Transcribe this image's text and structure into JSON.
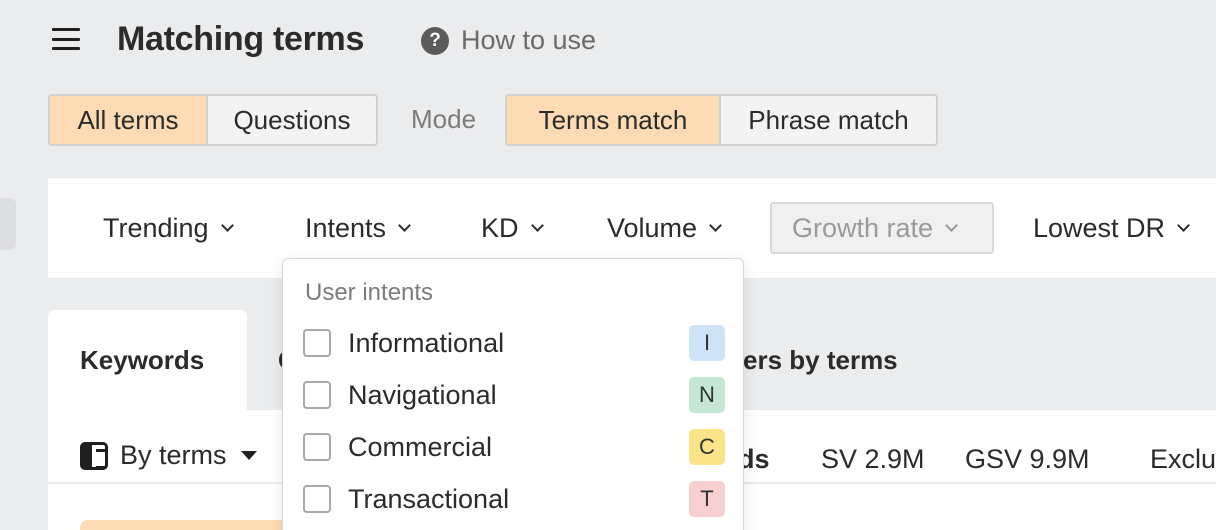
{
  "header": {
    "title": "Matching terms",
    "help_label": "How to use",
    "help_icon": "question-circle-icon",
    "menu_icon": "hamburger-menu-icon"
  },
  "terms_toggle": {
    "options": [
      "All terms",
      "Questions"
    ],
    "selected": "All terms"
  },
  "mode": {
    "label": "Mode",
    "options": [
      "Terms match",
      "Phrase match"
    ],
    "selected": "Terms match"
  },
  "filters": [
    {
      "label": "Trending",
      "disabled": false
    },
    {
      "label": "Intents",
      "disabled": false
    },
    {
      "label": "KD",
      "disabled": false
    },
    {
      "label": "Volume",
      "disabled": false
    },
    {
      "label": "Growth rate",
      "disabled": true
    },
    {
      "label": "Lowest DR",
      "disabled": false
    }
  ],
  "tabs": {
    "active": "Keywords",
    "partial_hidden_prefix": "C",
    "partial_visible_suffix": "ers by terms"
  },
  "toolbar": {
    "group_by_label": "By terms",
    "group_by_icon": "panel-layout-icon",
    "keywords_partial": "ords",
    "sv_stat": "SV 2.9M",
    "gsv_stat": "GSV 9.9M",
    "exclude_partial": "Exclu"
  },
  "intents_dropdown": {
    "heading": "User intents",
    "items": [
      {
        "label": "Informational",
        "badge": "I",
        "badge_color": "#cfe3f7",
        "checked": false
      },
      {
        "label": "Navigational",
        "badge": "N",
        "badge_color": "#c4e6d2",
        "checked": false
      },
      {
        "label": "Commercial",
        "badge": "C",
        "badge_color": "#fbe38a",
        "checked": false
      },
      {
        "label": "Transactional",
        "badge": "T",
        "badge_color": "#f8cfcf",
        "checked": false
      }
    ]
  },
  "colors": {
    "accent_selected": "#fddcb5",
    "background": "#ebecee",
    "panel": "#ffffff"
  }
}
